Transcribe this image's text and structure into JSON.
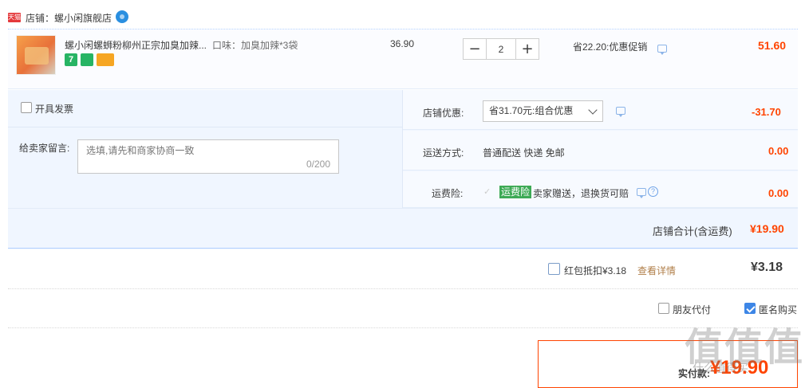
{
  "shop": {
    "badge": "天猫",
    "name": "店铺：螺小闲旗舰店"
  },
  "item": {
    "title": "螺小闲螺蛳粉柳州正宗加臭加辣...",
    "spec": "口味：加臭加辣*3袋",
    "service_badges": [
      "7",
      "",
      ""
    ],
    "unit_price": "36.90",
    "quantity": "2",
    "minus": "−",
    "plus": "+",
    "promo": "省22.20:优惠促销",
    "total": "51.60"
  },
  "invoice": {
    "label": "开具发票"
  },
  "message": {
    "label": "给卖家留言:",
    "placeholder": "选填,请先和商家协商一致",
    "count": "0/200"
  },
  "shop_discount": {
    "label": "店铺优惠:",
    "selected": "省31.70元:组合优惠",
    "amount": "-31.70"
  },
  "delivery": {
    "label": "运送方式:",
    "value": "普通配送 快递 免邮",
    "amount": "0.00"
  },
  "insurance": {
    "label": "运费险:",
    "badge": "运费险",
    "text": "卖家赠送，退换货可赔",
    "help": "?",
    "amount": "0.00"
  },
  "subtotal": {
    "label": "店铺合计(含运费)",
    "amount": "¥19.90"
  },
  "red_packet": {
    "label": "红包抵扣¥3.18",
    "link": "查看详情",
    "amount": "¥3.18"
  },
  "options": {
    "friend_pay": "朋友代付",
    "anonymous": "匿名购买"
  },
  "payment": {
    "label": "实付款:",
    "amount": "¥19.90"
  },
  "watermark": {
    "main": "值值值",
    "sub": "什么值得买"
  },
  "colors": {
    "accent_red": "#ff4400",
    "light_blue_bg": "#f0f6ff",
    "checkbox_blue": "#3d86e6",
    "insurance_green": "#3daa55"
  }
}
